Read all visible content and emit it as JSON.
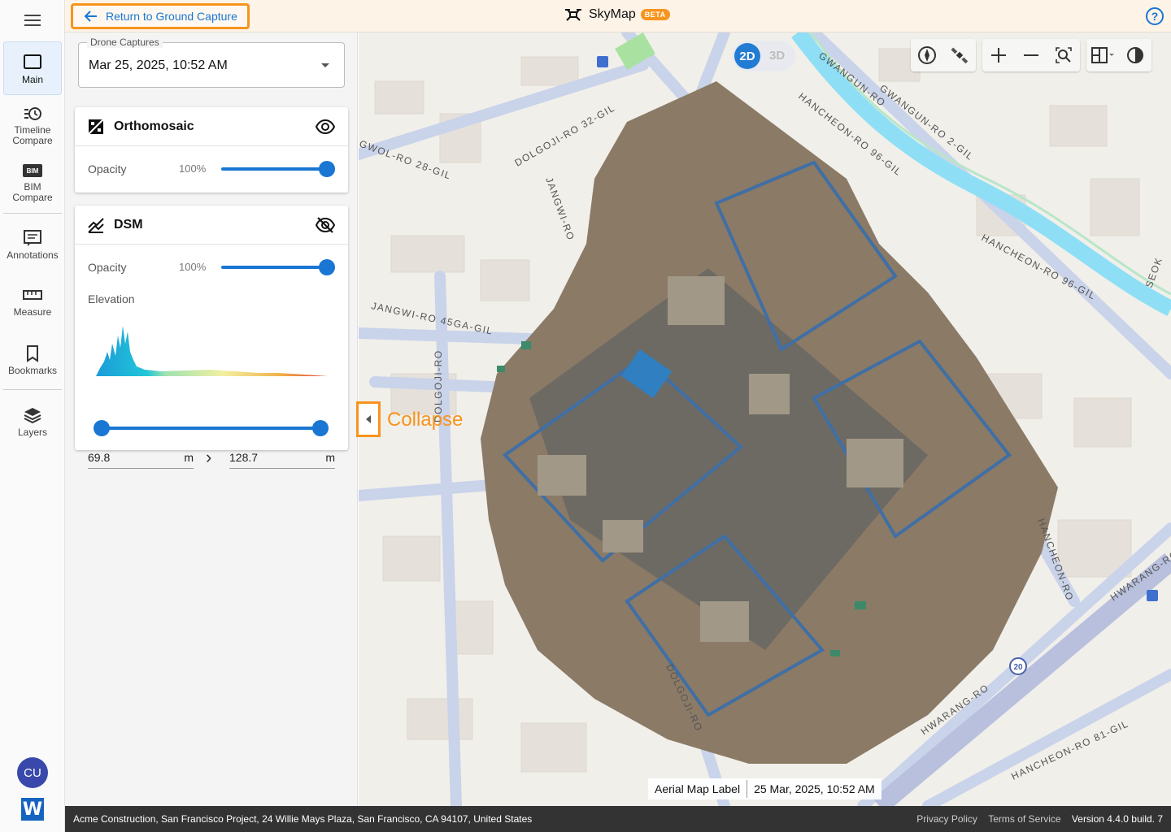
{
  "topbar": {
    "back_label": "Return to Ground Capture",
    "app_name": "SkyMap",
    "beta_badge": "BETA",
    "help_glyph": "?",
    "accent_color": "#f7941d",
    "primary_color": "#1976d2"
  },
  "rail": {
    "items": [
      {
        "label": "Main",
        "icon": "monitor-icon"
      },
      {
        "label": "Timeline Compare",
        "icon": "timeline-icon"
      },
      {
        "label": "BIM Compare",
        "icon": "bim-icon"
      },
      {
        "label": "Annotations",
        "icon": "annotations-icon"
      },
      {
        "label": "Measure",
        "icon": "ruler-icon"
      },
      {
        "label": "Bookmarks",
        "icon": "bookmark-icon"
      },
      {
        "label": "Layers",
        "icon": "layers-icon"
      }
    ],
    "bim_icon_text": "BIM",
    "avatar_initials": "CU",
    "logo_letter": "W"
  },
  "panel": {
    "capture_label": "Drone Captures",
    "capture_value": "Mar 25, 2025, 10:52 AM",
    "ortho": {
      "title": "Orthomosaic",
      "opacity_label": "Opacity",
      "opacity_value": "100%",
      "opacity": 1.0,
      "visible": true
    },
    "dsm": {
      "title": "DSM",
      "opacity_label": "Opacity",
      "opacity_value": "100%",
      "opacity": 1.0,
      "visible": false,
      "elevation_label": "Elevation",
      "min_value": "69.8",
      "max_value": "128.7",
      "unit": "m",
      "range_arrow": "›"
    },
    "collapse_label": "Collapse"
  },
  "map": {
    "mode_2d": "2D",
    "mode_3d": "3D",
    "tools": [
      "compass-icon",
      "satellite-icon",
      "zoom-in-icon",
      "zoom-out-icon",
      "zoom-extent-icon",
      "split-view-icon",
      "contrast-icon"
    ],
    "streets": [
      "DOLGOJI-RO 32-GIL",
      "GWANGUN-RO",
      "GWANGUN-RO 2-GIL",
      "HANCHEON-RO 96-GIL",
      "HANCHEON-RO 96-GIL",
      "JANGWI-RO",
      "GWOL-RO 28-GIL",
      "JANGWI-RO 45GA-GIL",
      "DOLGOJI-RO",
      "HWARANG-RO",
      "HANCHEON-RO 81-GIL",
      "HANCHEON-RO",
      "HWARANG-RO",
      "DOLGOJI-RO",
      "SEOK"
    ],
    "route_number": "20",
    "label_title": "Aerial Map Label",
    "label_date": "25 Mar, 2025, 10:52 AM"
  },
  "footer": {
    "address": "Acme Construction, San Francisco Project, 24 Willie Mays Plaza, San Francisco, CA 94107, United States",
    "privacy": "Privacy Policy",
    "terms": "Terms of Service",
    "version": "Version 4.4.0 build. 7"
  }
}
